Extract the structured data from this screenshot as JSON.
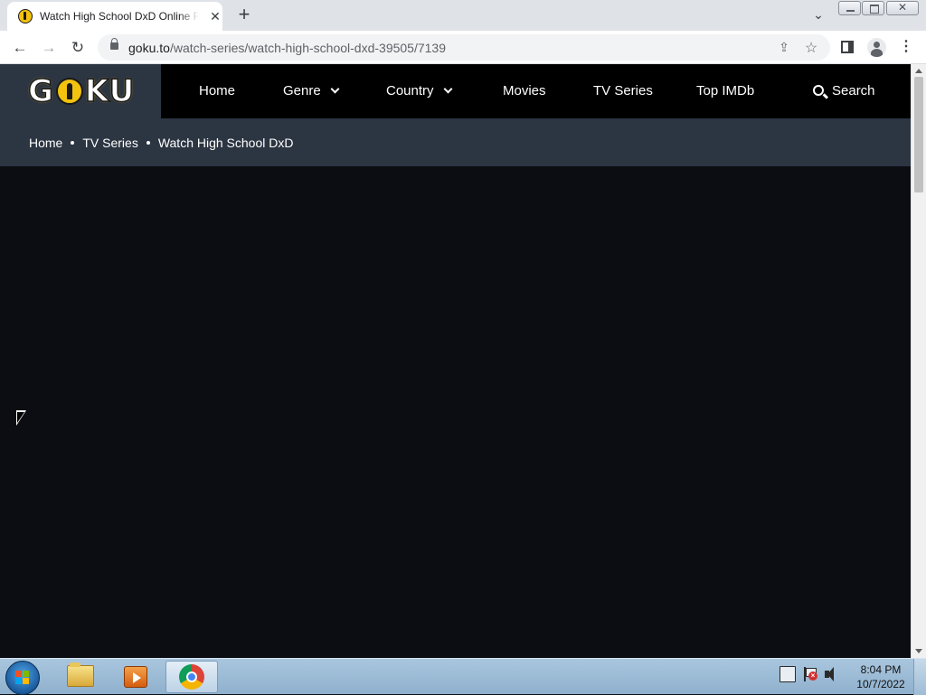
{
  "browser": {
    "tab": {
      "title": "Watch High School DxD Online Free",
      "favicon": "goku-favicon-icon",
      "close_glyph": "✕"
    },
    "new_tab_glyph": "+",
    "tab_search_glyph": "⌄",
    "window_close_glyph": "✕",
    "nav": {
      "back_glyph": "←",
      "forward_glyph": "→",
      "reload_glyph": "↻"
    },
    "address": {
      "domain": "goku.to",
      "path": "/watch-series/watch-high-school-dxd-39505/7139"
    },
    "share_glyph": "⇪",
    "star_glyph": "☆",
    "menu_glyph": "⋮"
  },
  "site": {
    "logo": {
      "before": "G",
      "after": "KU"
    },
    "nav": {
      "home": "Home",
      "genre": "Genre",
      "country": "Country",
      "movies": "Movies",
      "tv_series": "TV Series",
      "top_imdb": "Top IMDb",
      "search": "Search"
    },
    "breadcrumb": {
      "items": [
        "Home",
        "TV Series",
        "Watch High School DxD"
      ]
    }
  },
  "taskbar": {
    "clock": {
      "time": "8:04 PM",
      "date": "10/7/2022"
    }
  },
  "colors": {
    "page_bg": "#0c0d12",
    "header_bg": "#000000",
    "subheader_bg": "#2c3542",
    "accent_yellow": "#f2c20f"
  }
}
